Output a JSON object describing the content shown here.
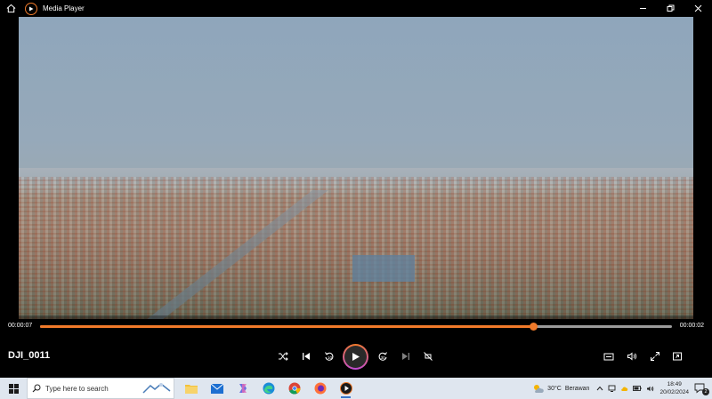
{
  "window": {
    "title": "Media Player",
    "home_icon": "home-icon",
    "app_icon": "media-player-logo-icon",
    "controls": [
      "minimize-icon",
      "restore-icon",
      "close-icon"
    ]
  },
  "player": {
    "file_name": "DJI_0011",
    "elapsed": "00:00:07",
    "remaining": "00:00:02",
    "progress_fraction": 0.78,
    "accent_color": "#f07a2a",
    "buttons": {
      "shuffle": "shuffle-icon",
      "previous": "previous-icon",
      "rewind": "10",
      "play": "play-icon",
      "forward": "30",
      "next": "next-icon",
      "repeat": "repeat-off-icon",
      "miniplayer": "miniplayer-icon",
      "volume": "volume-icon",
      "fullscreen": "fullscreen-icon",
      "more": "more-options-icon"
    }
  },
  "taskbar": {
    "search_placeholder": "Type here to search",
    "apps": [
      "file-explorer-icon",
      "mail-icon",
      "copilot-icon",
      "edge-icon",
      "chrome-icon",
      "firefox-icon",
      "media-player-icon"
    ],
    "weather_temp": "30°C",
    "weather_text": "Berawan",
    "time": "18:49",
    "date": "20/02/2024",
    "notification_count": "2"
  }
}
